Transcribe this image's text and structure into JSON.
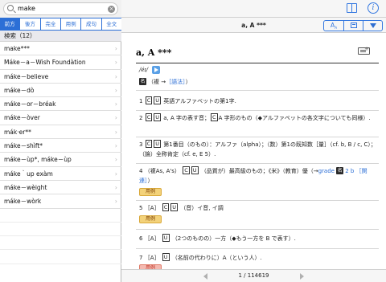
{
  "search": {
    "query": "make",
    "clear_label": "×"
  },
  "modes": [
    "前方",
    "後方",
    "完全",
    "用例",
    "成句",
    "全文"
  ],
  "results_header": "検索（12）",
  "results": [
    "make***",
    "Máke－a－Wish Foundàtion",
    "máke－believe",
    "máke－dò",
    "máke－or－bréak",
    "máke－òver",
    "mák·er**",
    "máke－shìft*",
    "máke－ùp*, máke－ùp",
    "máke｀up exàm",
    "máke－wèight",
    "máke－wòrk"
  ],
  "entry": {
    "title": "a, A ***",
    "headword": "a, A ***",
    "pronunciation": "/éɪ/",
    "plural": {
      "badge": "名",
      "text": "（複 →",
      "link": "［語法］",
      "end": "）"
    },
    "senses": [
      {
        "num": "1",
        "b1": "C",
        "b2": "U",
        "text": "英語アルファベットの第1字."
      },
      {
        "num": "2",
        "b1": "C",
        "b2": "U",
        "text": "a, A 字の表す音；",
        "b3": "C",
        "text2": "A 字形のもの（◆アルファベットの各文字についても同様）."
      },
      {
        "num": "3",
        "b1": "C",
        "b2": "U",
        "text": "第1番目（のもの）：アルファ（alpha）；（数）第1の既知数［量］（cf. b, B / c, C）；（論）全称肯定（cf. e, E 5）."
      },
      {
        "num": "4",
        "lead": "（複As, A's）",
        "b1": "C",
        "b2": "U",
        "text": "（品質が）最高級のもの；《米》（教育）優（→",
        "link1": "grade",
        "badge": "名",
        "link2": "2 b ［関連］",
        "end": "）"
      },
      {
        "num": "5",
        "lead": "［A］",
        "b1": "C",
        "b2": "U",
        "text": "（音）イ音, イ調"
      },
      {
        "num": "6",
        "lead": "［A］",
        "b1": "U",
        "text": "（2つのものの）一方（◆もう一方を B で表す）."
      },
      {
        "num": "7",
        "lead": "［A］",
        "b1": "U",
        "text": "（名前の代わりに）A（という人）."
      }
    ],
    "example_label": "用例"
  },
  "pager": {
    "text": "1 / 114619"
  },
  "toolbar": {
    "font_label": "A",
    "font_sub": "A"
  }
}
